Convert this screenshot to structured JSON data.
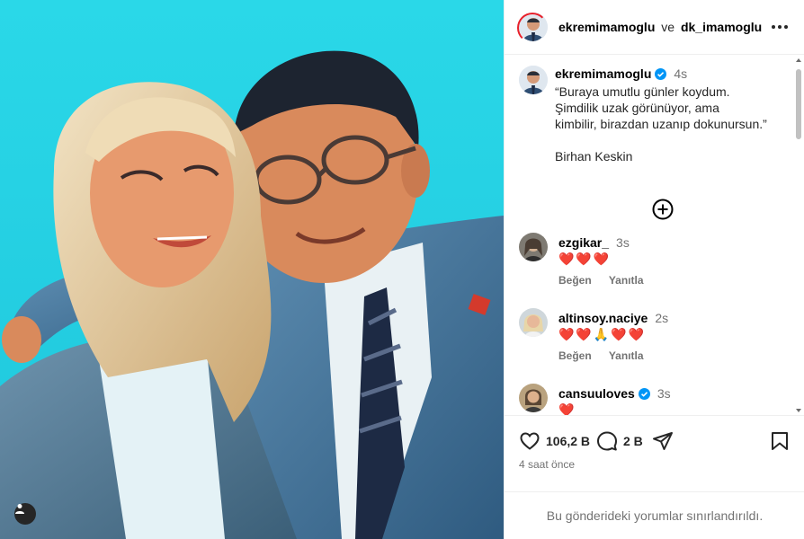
{
  "post": {
    "authors": [
      "ekremimamoglu",
      "dk_imamoglu"
    ],
    "conjunction": "ve"
  },
  "caption": {
    "username": "ekremimamoglu",
    "time": "4s",
    "text": "“Buraya umutlu günler koydum.\nŞimdilik uzak görünüyor, ama\nkimbilir, birazdan uzanıp dokunursun.”\n\nBirhan Keskin"
  },
  "comments": [
    {
      "username": "ezgikar_",
      "time": "3s",
      "text": "❤️❤️❤️",
      "like_label": "Beğen",
      "reply_label": "Yanıtla",
      "verified": false
    },
    {
      "username": "altinsoy.naciye",
      "time": "2s",
      "text": "❤️❤️🙏❤️❤️",
      "like_label": "Beğen",
      "reply_label": "Yanıtla",
      "verified": false
    },
    {
      "username": "cansuuloves",
      "time": "3s",
      "text": "❤️",
      "verified": true
    }
  ],
  "stats": {
    "likes": "106,2 B",
    "comments": "2 B",
    "date": "4 saat önce"
  },
  "footer": {
    "notice": "Bu gönderideki yorumlar sınırlandırıldı."
  },
  "colors": {
    "background_cyan": "#27d6e6",
    "verified_blue": "#0095f6",
    "heart_red": "#ed3b5c"
  },
  "icons": [
    "more-icon",
    "verified-icon",
    "add-circle-icon",
    "heart-icon",
    "comment-icon",
    "share-icon",
    "bookmark-icon",
    "user-tag-icon"
  ]
}
